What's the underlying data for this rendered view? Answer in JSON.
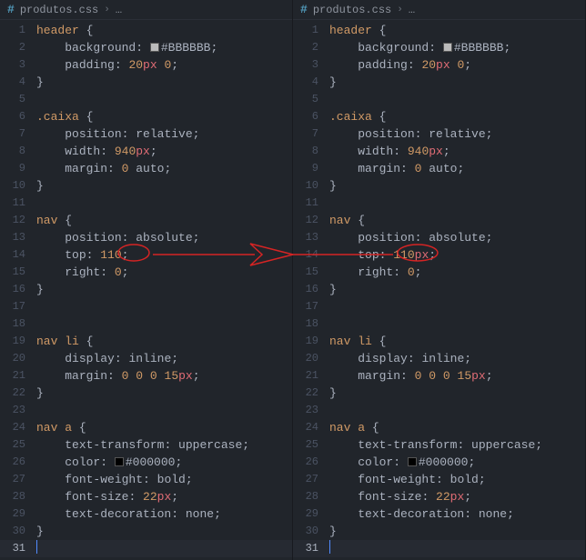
{
  "breadcrumb_file": "produtos.css",
  "breadcrumb_more": "…",
  "current_line": 31,
  "left_top_value": "110",
  "left_top_unit": "",
  "right_top_value": "110",
  "right_top_unit": "px",
  "lines": [
    {
      "n": 1,
      "type": "sel",
      "text": "header {"
    },
    {
      "n": 2,
      "type": "prop",
      "indent": 2,
      "prop": "background",
      "swatch": "#BBBBBB",
      "hex": "#BBBBBB"
    },
    {
      "n": 3,
      "type": "prop",
      "indent": 2,
      "prop": "padding",
      "val_parts": [
        {
          "t": "num",
          "v": "20"
        },
        {
          "t": "unit",
          "v": "px"
        },
        {
          "t": "txt",
          "v": " "
        },
        {
          "t": "num",
          "v": "0"
        }
      ]
    },
    {
      "n": 4,
      "type": "close"
    },
    {
      "n": 5,
      "type": "blank"
    },
    {
      "n": 6,
      "type": "sel",
      "text": ".caixa {"
    },
    {
      "n": 7,
      "type": "prop",
      "indent": 2,
      "prop": "position",
      "val": "relative"
    },
    {
      "n": 8,
      "type": "prop",
      "indent": 2,
      "prop": "width",
      "val_parts": [
        {
          "t": "num",
          "v": "940"
        },
        {
          "t": "unit",
          "v": "px"
        }
      ]
    },
    {
      "n": 9,
      "type": "prop",
      "indent": 2,
      "prop": "margin",
      "val_parts": [
        {
          "t": "num",
          "v": "0"
        },
        {
          "t": "txt",
          "v": " auto"
        }
      ]
    },
    {
      "n": 10,
      "type": "close"
    },
    {
      "n": 11,
      "type": "blank"
    },
    {
      "n": 12,
      "type": "sel",
      "text": "nav {"
    },
    {
      "n": 13,
      "type": "prop",
      "indent": 2,
      "prop": "position",
      "val": "absolute"
    },
    {
      "n": 14,
      "type": "top"
    },
    {
      "n": 15,
      "type": "prop",
      "indent": 2,
      "prop": "right",
      "val_parts": [
        {
          "t": "num",
          "v": "0"
        }
      ]
    },
    {
      "n": 16,
      "type": "close"
    },
    {
      "n": 17,
      "type": "blank"
    },
    {
      "n": 18,
      "type": "blank"
    },
    {
      "n": 19,
      "type": "sel",
      "text": "nav li {"
    },
    {
      "n": 20,
      "type": "prop",
      "indent": 2,
      "prop": "display",
      "val": "inline"
    },
    {
      "n": 21,
      "type": "prop",
      "indent": 2,
      "prop": "margin",
      "val_parts": [
        {
          "t": "num",
          "v": "0"
        },
        {
          "t": "txt",
          "v": " "
        },
        {
          "t": "num",
          "v": "0"
        },
        {
          "t": "txt",
          "v": " "
        },
        {
          "t": "num",
          "v": "0"
        },
        {
          "t": "txt",
          "v": " "
        },
        {
          "t": "num",
          "v": "15"
        },
        {
          "t": "unit",
          "v": "px"
        }
      ]
    },
    {
      "n": 22,
      "type": "close"
    },
    {
      "n": 23,
      "type": "blank"
    },
    {
      "n": 24,
      "type": "sel",
      "text": "nav a {"
    },
    {
      "n": 25,
      "type": "prop",
      "indent": 2,
      "prop": "text-transform",
      "val": "uppercase"
    },
    {
      "n": 26,
      "type": "prop",
      "indent": 2,
      "prop": "color",
      "swatch": "#000000",
      "hex": "#000000"
    },
    {
      "n": 27,
      "type": "prop",
      "indent": 2,
      "prop": "font-weight",
      "val": "bold"
    },
    {
      "n": 28,
      "type": "prop",
      "indent": 2,
      "prop": "font-size",
      "val_parts": [
        {
          "t": "num",
          "v": "22"
        },
        {
          "t": "unit",
          "v": "px"
        }
      ]
    },
    {
      "n": 29,
      "type": "prop",
      "indent": 2,
      "prop": "text-decoration",
      "val": "none"
    },
    {
      "n": 30,
      "type": "close"
    },
    {
      "n": 31,
      "type": "cursor"
    }
  ]
}
